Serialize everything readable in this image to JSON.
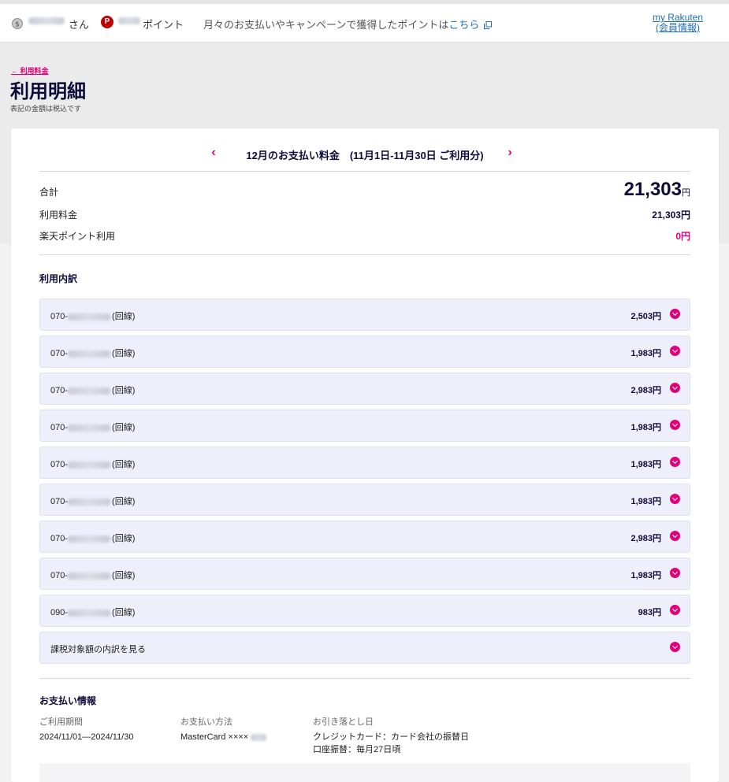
{
  "header": {
    "user_suffix": "さん",
    "point_badge": "P",
    "point_label": "ポイント",
    "notice_text": "月々のお支払いやキャンペーンで獲得したポイントは",
    "notice_link": "こちら",
    "my_rakuten_line1": "my Rakuten",
    "my_rakuten_line2": "(会員情報)"
  },
  "page": {
    "back_link": "← 利用料金",
    "title": "利用明細",
    "tax_note": "表記の金額は税込です"
  },
  "period": {
    "title": "12月のお支払い料金　(11月1日-11月30日 ご利用分)"
  },
  "summary": {
    "total_label": "合計",
    "total_amount": "21,303",
    "yen": "円",
    "usage_label": "利用料金",
    "usage_amount": "21,303円",
    "points_label": "楽天ポイント利用",
    "points_amount": "0円"
  },
  "breakdown": {
    "title": "利用内訳",
    "lines": [
      {
        "prefix": "070-",
        "suffix": "(回線)",
        "amount": "2,503円"
      },
      {
        "prefix": "070-",
        "suffix": "(回線)",
        "amount": "1,983円"
      },
      {
        "prefix": "070-",
        "suffix": "(回線)",
        "amount": "2,983円"
      },
      {
        "prefix": "070-",
        "suffix": "(回線)",
        "amount": "1,983円"
      },
      {
        "prefix": "070-",
        "suffix": "(回線)",
        "amount": "1,983円"
      },
      {
        "prefix": "070-",
        "suffix": "(回線)",
        "amount": "1,983円"
      },
      {
        "prefix": "070-",
        "suffix": "(回線)",
        "amount": "2,983円"
      },
      {
        "prefix": "070-",
        "suffix": "(回線)",
        "amount": "1,983円"
      },
      {
        "prefix": "090-",
        "suffix": "(回線)",
        "amount": "983円"
      }
    ],
    "tax_breakdown_label": "課税対象額の内訳を見る"
  },
  "payment": {
    "title": "お支払い情報",
    "period_header": "ご利用期間",
    "period_value": "2024/11/01—2024/11/30",
    "method_header": "お支払い方法",
    "method_value": "MasterCard ××××",
    "debit_header": "お引き落とし日",
    "debit_line1": "クレジットカード：カード会社の振替日",
    "debit_line2": "口座振替：毎月27日頃"
  },
  "colors": {
    "accent": "#e0007a",
    "heading": "#0d0a3a",
    "link": "#1d6fb8",
    "row_bg": "#efeefb"
  }
}
